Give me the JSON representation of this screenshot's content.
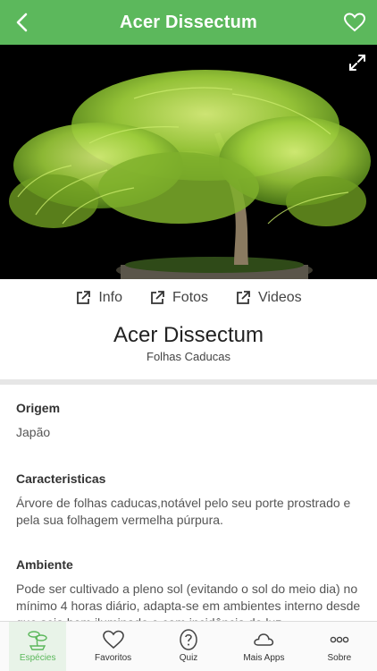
{
  "header": {
    "title": "Acer Dissectum"
  },
  "links": [
    {
      "label": "Info"
    },
    {
      "label": "Fotos"
    },
    {
      "label": "Videos"
    }
  ],
  "species": {
    "name": "Acer Dissectum",
    "category": "Folhas Caducas"
  },
  "sections": [
    {
      "title": "Origem",
      "text": "Japão"
    },
    {
      "title": "Caracteristicas",
      "text": "Árvore de folhas caducas,notável pelo seu porte prostrado e pela sua folhagem vermelha púrpura."
    },
    {
      "title": "Ambiente",
      "text": "Pode ser cultivado a pleno sol (evitando o sol do meio dia) no mínimo 4 horas diário, adapta-se em ambientes interno desde que seja bem iluminado e com incidência de luz"
    }
  ],
  "tabs": [
    {
      "label": "Espécies",
      "icon": "bonsai-icon"
    },
    {
      "label": "Favoritos",
      "icon": "heart-icon"
    },
    {
      "label": "Quiz",
      "icon": "question-icon"
    },
    {
      "label": "Mais Apps",
      "icon": "cloud-icon"
    },
    {
      "label": "Sobre",
      "icon": "more-dots-icon"
    }
  ],
  "colors": {
    "accent": "#5cb85c",
    "tab_active_bg": "#e8f3e8",
    "divider": "#e6e6e6"
  }
}
